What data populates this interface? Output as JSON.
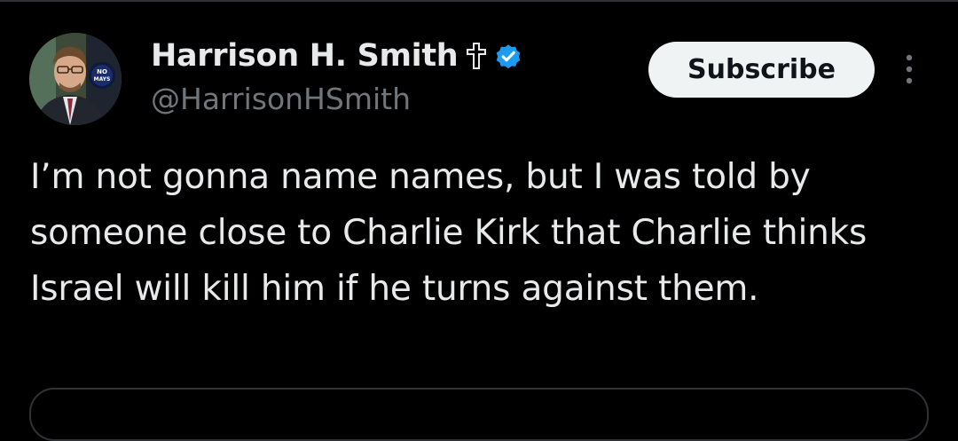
{
  "tweet": {
    "author": {
      "display_name": "Harrison H. Smith",
      "handle": "@HarrisonHSmith",
      "avatar_badge_text": "NO MAYS",
      "verified_color": "#1d9bf0"
    },
    "subscribe_label": "Subscribe",
    "text": "I’m not gonna name names, but I was told by someone close to Charlie Kirk that Charlie thinks Israel will kill him if he turns against them."
  },
  "icons": {
    "cross": "cross-icon",
    "verified": "verified-badge-icon",
    "more": "more-options-icon"
  },
  "colors": {
    "background": "#000000",
    "text_primary": "#e7e9ea",
    "text_secondary": "#71767b",
    "button_bg": "#eff3f4",
    "button_text": "#0f1419",
    "divider": "#2f3336"
  }
}
